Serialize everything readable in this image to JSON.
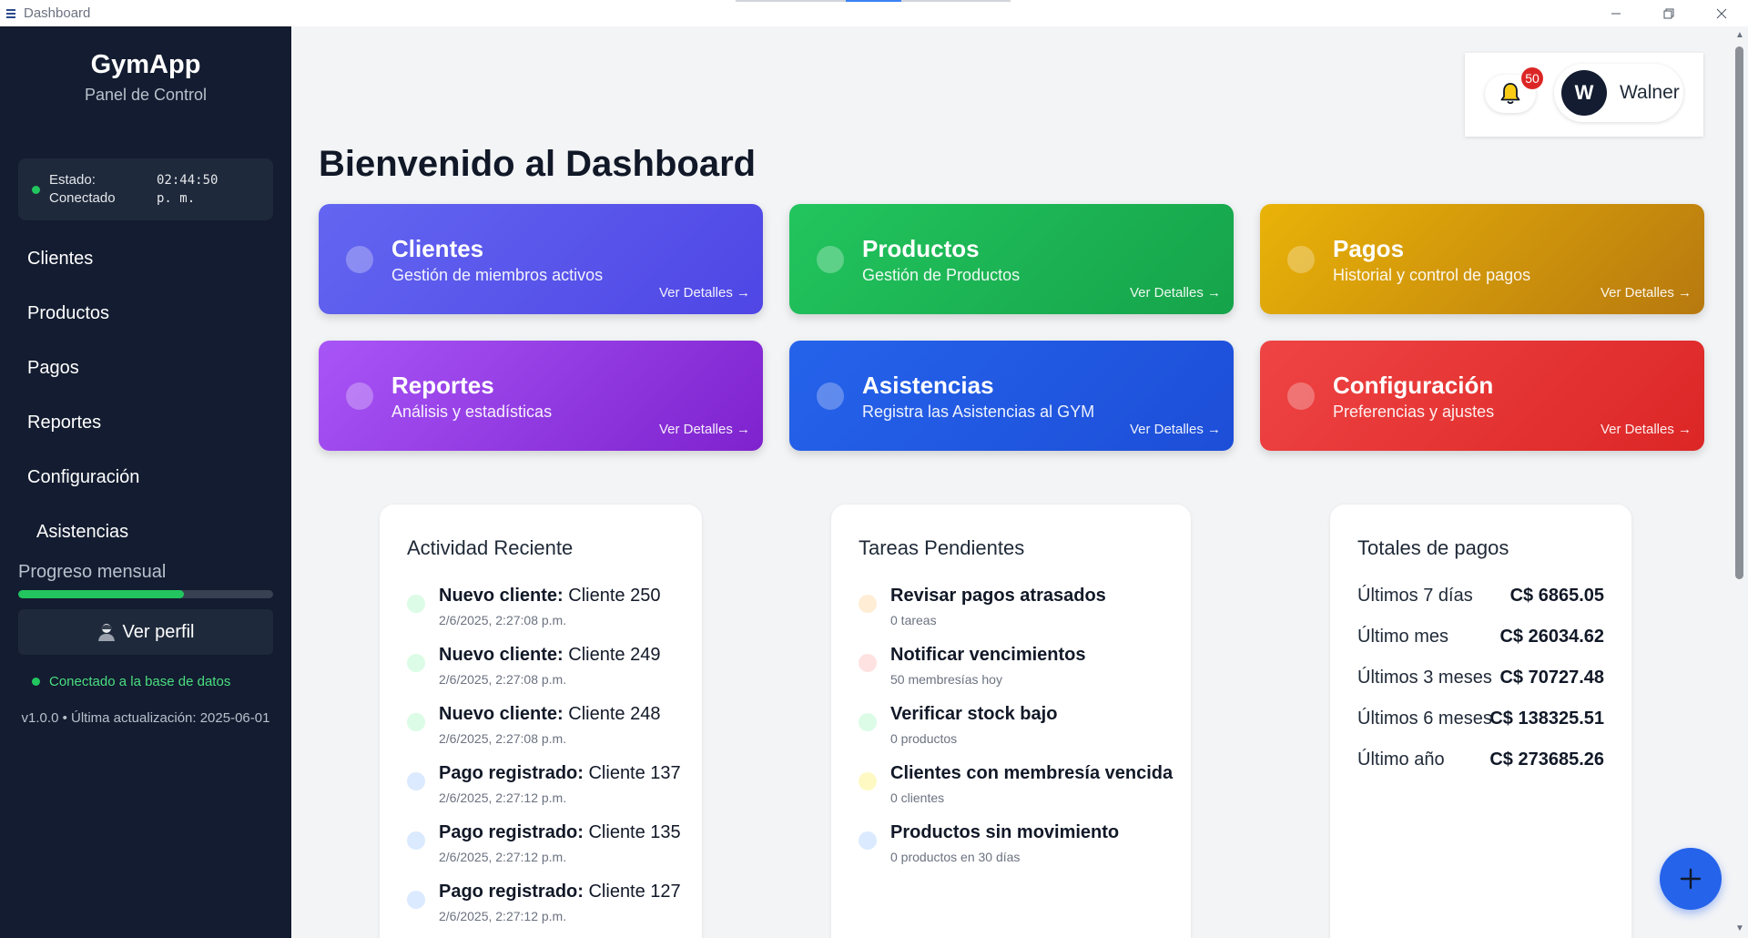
{
  "window": {
    "title": "Dashboard"
  },
  "sidebar": {
    "brand": "GymApp",
    "subtitle": "Panel de Control",
    "status": {
      "label_line1": "Estado:",
      "label_line2": "Conectado",
      "time_line1": "02:44:50",
      "time_line2": "p. m.",
      "color": "#22c55e"
    },
    "items": [
      {
        "label": "Clientes"
      },
      {
        "label": "Productos"
      },
      {
        "label": "Pagos"
      },
      {
        "label": "Reportes"
      },
      {
        "label": "Configuración"
      },
      {
        "label": "Asistencias"
      }
    ],
    "progress": {
      "label": "Progreso mensual",
      "fraction": 0.65
    },
    "profile_button": "Ver perfil",
    "db_status": "Conectado a la base de datos",
    "version": "v1.0.0 • Última actualización: 2025-06-01"
  },
  "header": {
    "notifications": {
      "count": "50",
      "icon": "bell-icon"
    },
    "user": {
      "initial": "W",
      "name": "Walner"
    }
  },
  "page_title": "Bienvenido al Dashboard",
  "cards": [
    {
      "title": "Clientes",
      "subtitle": "Gestión de miembros activos",
      "link": "Ver Detalles →",
      "color": "#4f46e5"
    },
    {
      "title": "Productos",
      "subtitle": "Gestión de Productos",
      "link": "Ver Detalles →",
      "color": "#16a34a"
    },
    {
      "title": "Pagos",
      "subtitle": "Historial y control de pagos",
      "link": "Ver Detalles →",
      "color": "#ca8a04"
    },
    {
      "title": "Reportes",
      "subtitle": "Análisis y estadísticas",
      "link": "Ver Detalles →",
      "color": "#9333ea"
    },
    {
      "title": "Asistencias",
      "subtitle": "Registra las Asistencias al GYM",
      "link": "Ver Detalles →",
      "color": "#1d4ed8"
    },
    {
      "title": "Configuración",
      "subtitle": "Preferencias y ajustes",
      "link": "Ver Detalles →",
      "color": "#dc2626"
    }
  ],
  "activity": {
    "title": "Actividad Reciente",
    "items": [
      {
        "type": "Nuevo cliente:",
        "text": "Cliente 250",
        "time": "2/6/2025, 2:27:08 p.m.",
        "color": "#dcfce7"
      },
      {
        "type": "Nuevo cliente:",
        "text": "Cliente 249",
        "time": "2/6/2025, 2:27:08 p.m.",
        "color": "#dcfce7"
      },
      {
        "type": "Nuevo cliente:",
        "text": "Cliente 248",
        "time": "2/6/2025, 2:27:08 p.m.",
        "color": "#dcfce7"
      },
      {
        "type": "Pago registrado:",
        "text": "Cliente 137",
        "time": "2/6/2025, 2:27:12 p.m.",
        "color": "#dbeafe"
      },
      {
        "type": "Pago registrado:",
        "text": "Cliente 135",
        "time": "2/6/2025, 2:27:12 p.m.",
        "color": "#dbeafe"
      },
      {
        "type": "Pago registrado:",
        "text": "Cliente 127",
        "time": "2/6/2025, 2:27:12 p.m.",
        "color": "#dbeafe"
      }
    ]
  },
  "tasks": {
    "title": "Tareas Pendientes",
    "items": [
      {
        "title": "Revisar pagos atrasados",
        "detail": "0 tareas",
        "color": "#ffedd5"
      },
      {
        "title": "Notificar vencimientos",
        "detail": "50 membresías hoy",
        "color": "#fee2e2"
      },
      {
        "title": "Verificar stock bajo",
        "detail": "0 productos",
        "color": "#dcfce7"
      },
      {
        "title": "Clientes con membresía vencida",
        "detail": "0 clientes",
        "color": "#fef9c3"
      },
      {
        "title": "Productos sin movimiento",
        "detail": "0 productos en 30 días",
        "color": "#dbeafe"
      }
    ]
  },
  "totals": {
    "title": "Totales de pagos",
    "rows": [
      {
        "period": "Últimos 7 días",
        "amount": "C$ 6865.05"
      },
      {
        "period": "Último mes",
        "amount": "C$ 26034.62"
      },
      {
        "period": "Últimos 3 meses",
        "amount": "C$ 70727.48"
      },
      {
        "period": "Últimos 6 meses",
        "amount": "C$ 138325.51"
      },
      {
        "period": "Último año",
        "amount": "C$ 273685.26"
      }
    ]
  },
  "fab": {
    "icon": "plus-icon"
  }
}
